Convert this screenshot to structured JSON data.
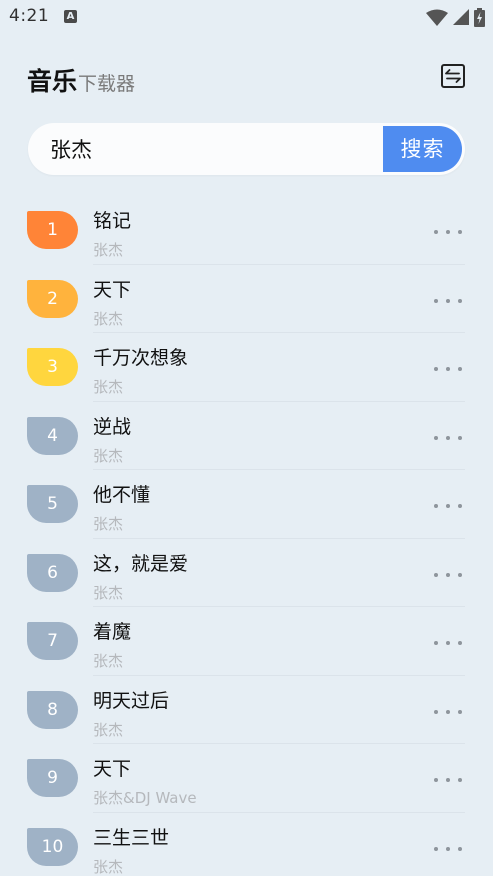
{
  "status_bar": {
    "time": "4:21",
    "notification_icon": "a-notification-icon"
  },
  "header": {
    "title": "音乐",
    "subtitle": "下载器"
  },
  "search": {
    "value": "张杰",
    "button_label": "搜索"
  },
  "colors": {
    "rank_1": "#ff8437",
    "rank_2": "#ffb33d",
    "rank_3": "#ffd63e",
    "rank_other": "#9fb2c6",
    "search_button": "#4f8cf0"
  },
  "songs": [
    {
      "rank": "1",
      "title": "铭记",
      "artist": "张杰"
    },
    {
      "rank": "2",
      "title": "天下",
      "artist": "张杰"
    },
    {
      "rank": "3",
      "title": "千万次想象",
      "artist": "张杰"
    },
    {
      "rank": "4",
      "title": "逆战",
      "artist": "张杰"
    },
    {
      "rank": "5",
      "title": "他不懂",
      "artist": "张杰"
    },
    {
      "rank": "6",
      "title": "这，就是爱",
      "artist": "张杰"
    },
    {
      "rank": "7",
      "title": "着魔",
      "artist": "张杰"
    },
    {
      "rank": "8",
      "title": "明天过后",
      "artist": "张杰"
    },
    {
      "rank": "9",
      "title": "天下",
      "artist": "张杰&DJ Wave"
    },
    {
      "rank": "10",
      "title": "三生三世",
      "artist": "张杰"
    }
  ]
}
